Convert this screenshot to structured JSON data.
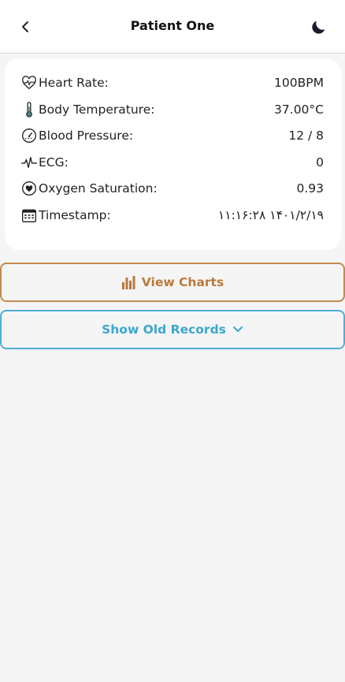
{
  "header": {
    "title": "Patient One",
    "back_icon": "chevron-left-icon",
    "theme_icon": "moon-icon"
  },
  "vitals": [
    {
      "icon": "heart-rate-icon",
      "label": "Heart Rate:",
      "value": "100BPM"
    },
    {
      "icon": "thermometer-icon",
      "label": "Body Temperature:",
      "value": "37.00°C"
    },
    {
      "icon": "gauge-icon",
      "label": "Blood Pressure:",
      "value": "12 / 8"
    },
    {
      "icon": "ecg-icon",
      "label": "ECG:",
      "value": "0"
    },
    {
      "icon": "oxygen-heart-icon",
      "label": "Oxygen Saturation:",
      "value": "0.93"
    },
    {
      "icon": "calendar-icon",
      "label": "Timestamp:",
      "value": "۱۴۰۱/۲/۱۹ ۱۱:۱۶:۲۸"
    }
  ],
  "actions": {
    "view_charts": "View Charts",
    "show_old_records": "Show Old Records"
  },
  "colors": {
    "charts_accent": "#b97a3c",
    "records_accent": "#3aa7cf",
    "background": "#f5f5f5",
    "card": "#ffffff"
  }
}
